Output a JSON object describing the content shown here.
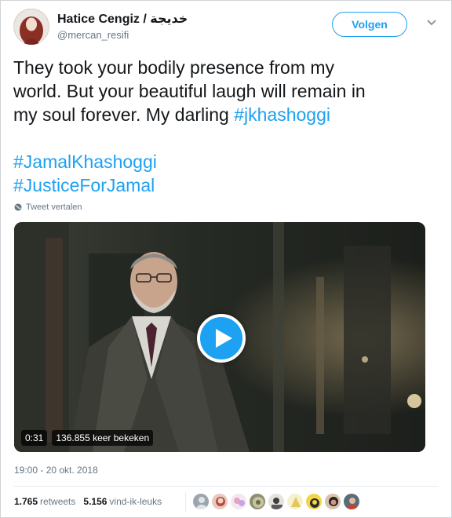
{
  "tweet": {
    "author": {
      "display_name": "Hatice Cengiz / خديجة",
      "handle": "@mercan_resifi",
      "avatar_icon": "profile-photo"
    },
    "follow_label": "Volgen",
    "menu_icon": "chevron-down-icon",
    "text": {
      "line1": "They took your bodily presence from my",
      "line2": "world. But your beautiful laugh will remain in",
      "line3_plain": "my soul forever. My darling ",
      "line3_tag": "#jkhashoggi",
      "hashtag1": "#JamalKhashoggi",
      "hashtag2": "#JusticeForJamal"
    },
    "translate_label": "Tweet vertalen",
    "video": {
      "duration": "0:31",
      "views": "136.855 keer bekeken"
    },
    "timestamp": "19:00 - 20 okt. 2018",
    "stats": {
      "retweets_count": "1.765",
      "retweets_label": "retweets",
      "likes_count": "5.156",
      "likes_label": "vind-ik-leuks"
    },
    "likers_count": 9
  },
  "colors": {
    "accent": "#1da1f2",
    "text": "#14171a",
    "muted": "#657786"
  }
}
